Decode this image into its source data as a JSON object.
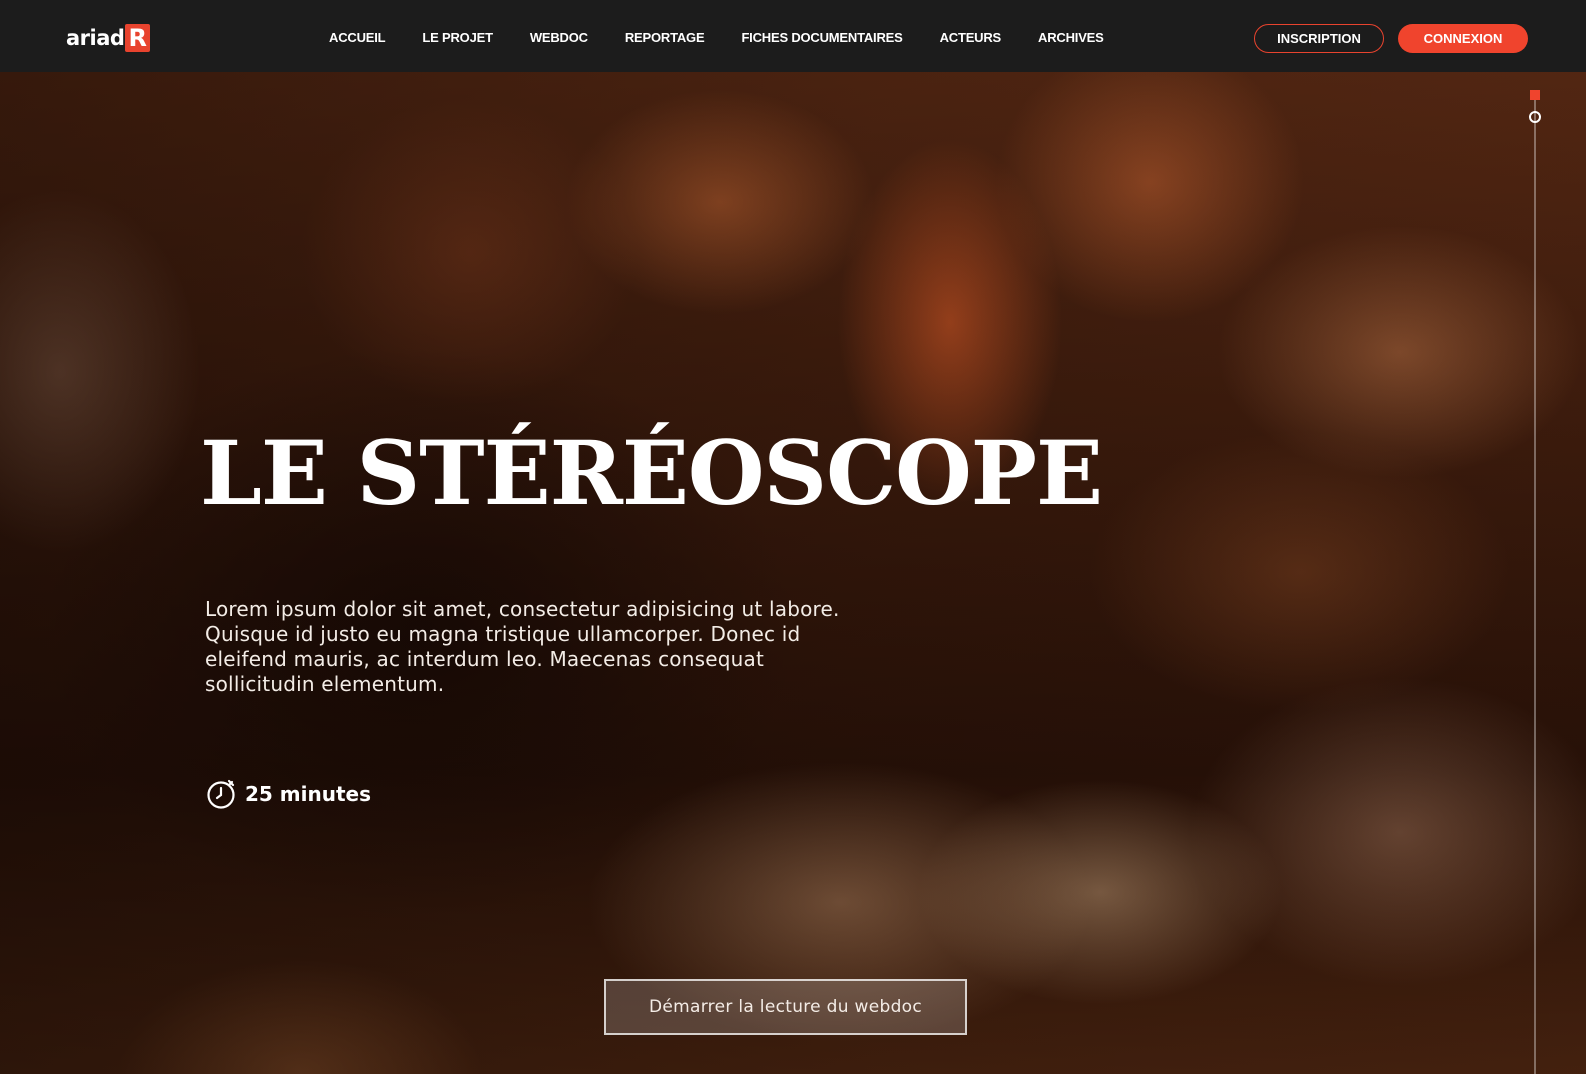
{
  "header": {
    "logo_text": "ariad",
    "logo_mark": "R",
    "nav": [
      {
        "label": "ACCUEIL"
      },
      {
        "label": "LE PROJET"
      },
      {
        "label": "WEBDOC"
      },
      {
        "label": "REPORTAGE"
      },
      {
        "label": "FICHES DOCUMENTAIRES"
      },
      {
        "label": "ACTEURS"
      },
      {
        "label": "ARCHIVES"
      }
    ],
    "inscription_label": "INSCRIPTION",
    "connexion_label": "CONNEXION"
  },
  "hero": {
    "title": "LE STÉRÉOSCOPE",
    "description": "Lorem ipsum dolor sit amet, consectetur adipisicing ut labore. Quisque id justo eu magna tristique ullamcorper. Donec id eleifend mauris, ac interdum leo. Maecenas consequat sollicitudin elementum.",
    "duration": "25 minutes",
    "duration_icon": "clock-icon",
    "cta_label": "Démarrer la lecture du webdoc"
  },
  "colors": {
    "accent": "#f0442d",
    "header_bg": "#1c1c1c",
    "text": "#ffffff"
  }
}
